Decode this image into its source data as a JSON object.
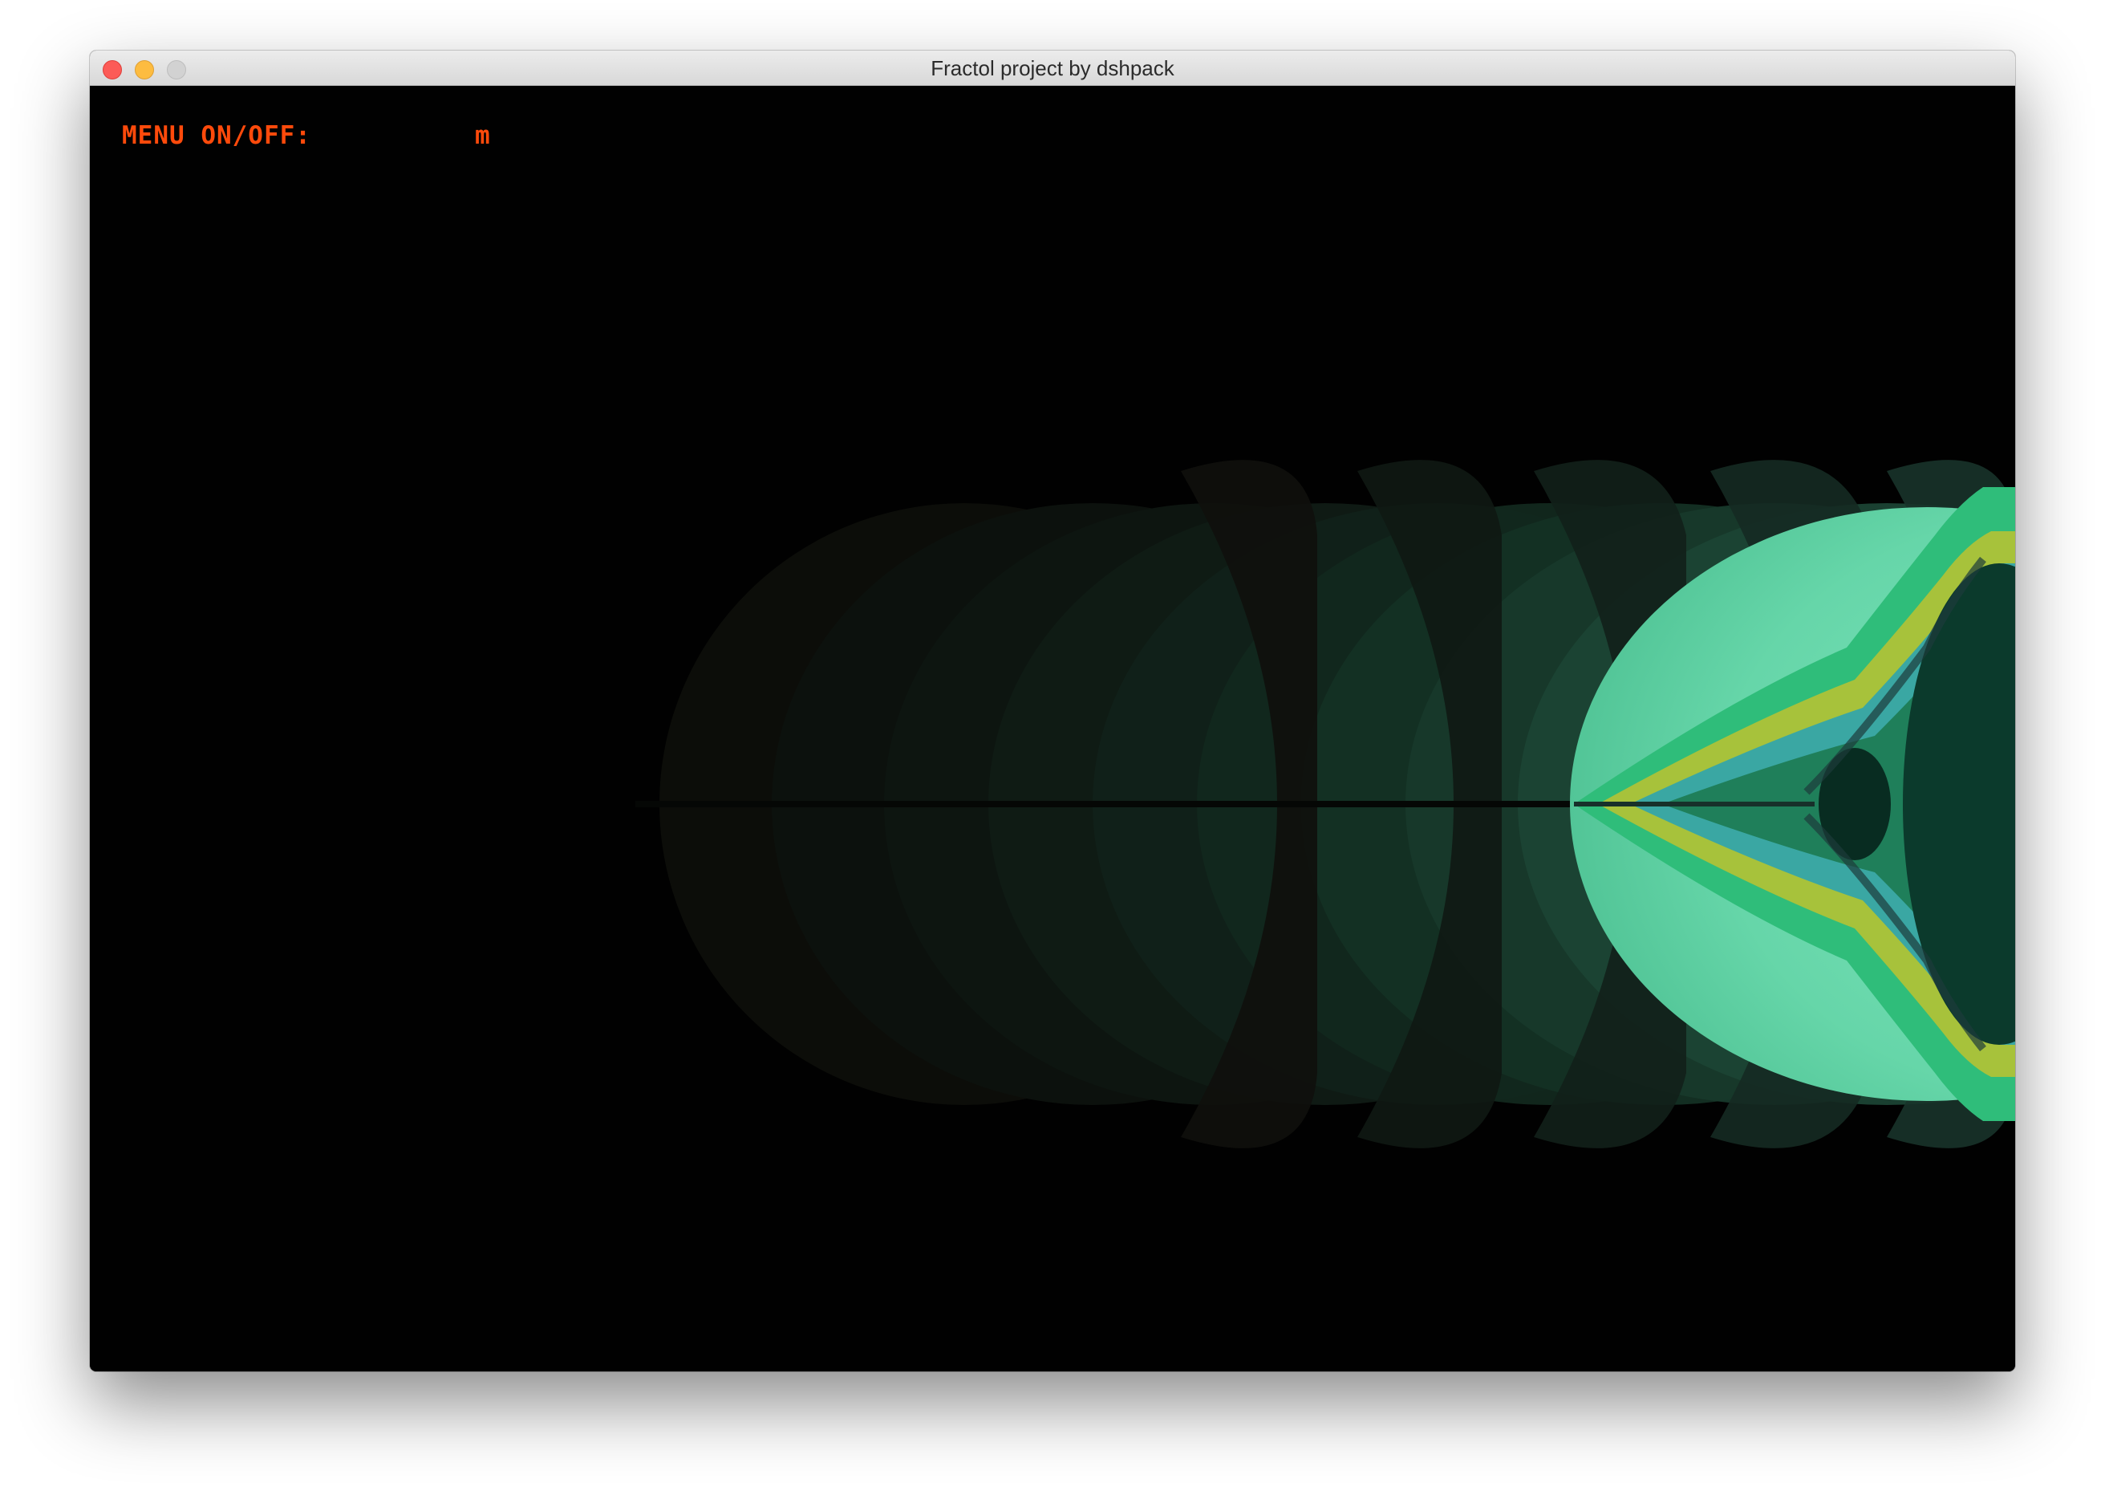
{
  "window": {
    "title": "Fractol project by dshpack"
  },
  "menu": {
    "label": "MENU ON/OFF:",
    "key": "m"
  },
  "colors": {
    "menu_text": "#ff4a0b",
    "background": "#010101",
    "fractal_primary": "#5fd5a5",
    "fractal_dark": "#0c3a2c",
    "fractal_accent": "#b5c23a"
  },
  "icons": {
    "close": "close-icon",
    "minimize": "minimize-icon",
    "zoom": "zoom-icon"
  }
}
